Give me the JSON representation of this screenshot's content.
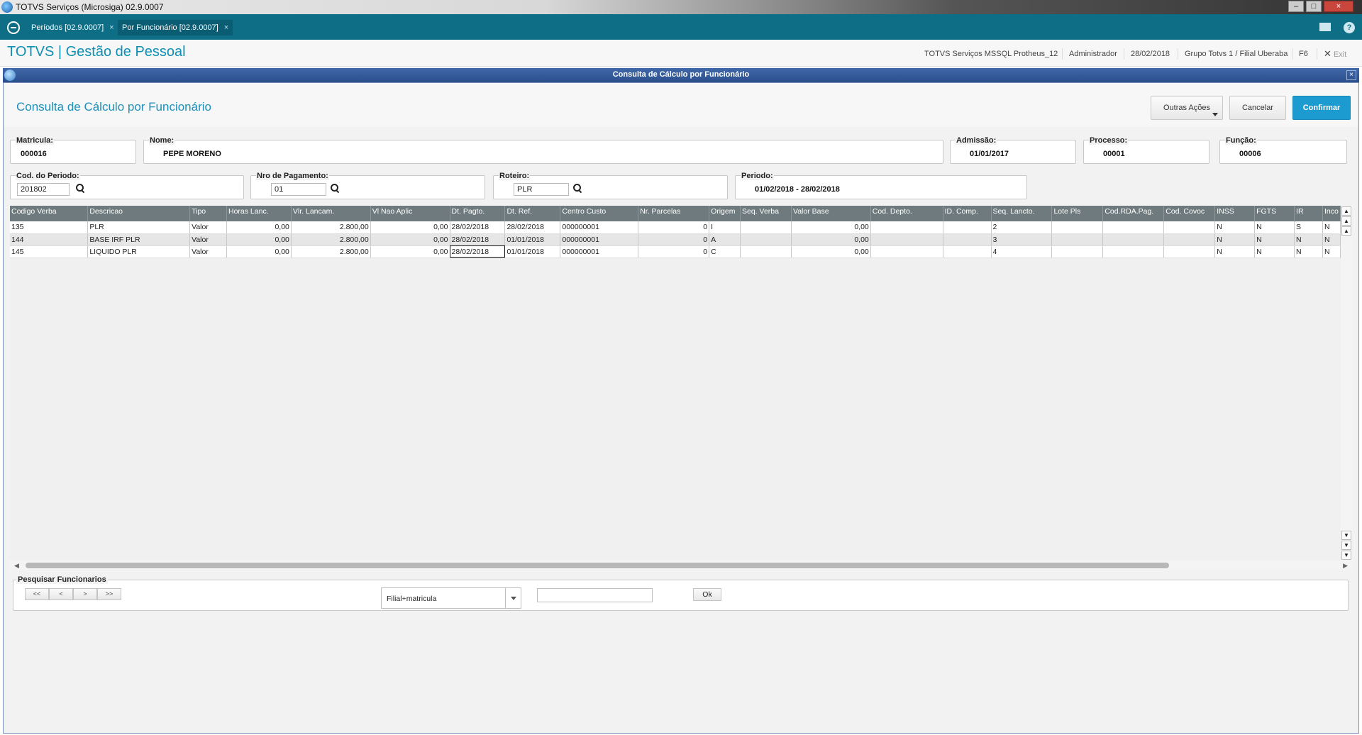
{
  "window": {
    "title": "TOTVS Serviços (Microsiga) 02.9.0007"
  },
  "tabs": [
    {
      "label": "Períodos [02.9.0007]",
      "close": "×"
    },
    {
      "label": "Por Funcionário [02.9.0007]",
      "close": "×"
    }
  ],
  "header": {
    "brand": "TOTVS | Gestão de Pessoal",
    "environment": "TOTVS Serviços MSSQL Protheus_12",
    "user": "Administrador",
    "date": "28/02/2018",
    "branch": "Grupo Totvs 1 / Filial Uberaba",
    "shortcut": "F6",
    "exit_label": "Exit",
    "help": "?"
  },
  "dialog": {
    "title": "Consulta de Cálculo por Funcionário",
    "heading": "Consulta de Cálculo por Funcionário",
    "buttons": {
      "more_actions": "Outras Ações",
      "cancel": "Cancelar",
      "confirm": "Confirmar"
    }
  },
  "fields": {
    "matricula": {
      "label": "Matricula:",
      "value": "000016"
    },
    "nome": {
      "label": "Nome:",
      "value": "PEPE MORENO"
    },
    "admissao": {
      "label": "Admissão:",
      "value": "01/01/2017"
    },
    "processo": {
      "label": "Processo:",
      "value": "00001"
    },
    "funcao": {
      "label": "Função:",
      "value": "00006"
    },
    "cod_periodo": {
      "label": "Cod. do Periodo:",
      "value": "201802"
    },
    "nro_pagamento": {
      "label": "Nro de Pagamento:",
      "value": "01"
    },
    "roteiro": {
      "label": "Roteiro:",
      "value": "PLR"
    },
    "periodo": {
      "label": "Periodo:",
      "value": "01/02/2018 - 28/02/2018"
    }
  },
  "grid": {
    "columns": [
      "Codigo Verba",
      "Descricao",
      "Tipo",
      "Horas Lanc.",
      "Vlr. Lancam.",
      "Vl Nao Aplic",
      "Dt. Pagto.",
      "Dt. Ref.",
      "Centro Custo",
      "Nr. Parcelas",
      "Origem",
      "Seq. Verba",
      "Valor Base",
      "Cod. Depto.",
      "ID. Comp.",
      "Seq. Lancto.",
      "Lote Pls",
      "Cod.RDA.Pag.",
      "Cod. Covoc",
      "INSS",
      "FGTS",
      "IR",
      "Inco"
    ],
    "rows": [
      [
        "135",
        "PLR",
        "Valor",
        "0,00",
        "2.800,00",
        "0,00",
        "28/02/2018",
        "28/02/2018",
        "000000001",
        "0",
        "I",
        "",
        "0,00",
        "",
        "",
        "2",
        "",
        "",
        "",
        "N",
        "N",
        "S",
        "N"
      ],
      [
        "144",
        "BASE IRF PLR",
        "Valor",
        "0,00",
        "2.800,00",
        "0,00",
        "28/02/2018",
        "01/01/2018",
        "000000001",
        "0",
        "A",
        "",
        "0,00",
        "",
        "",
        "3",
        "",
        "",
        "",
        "N",
        "N",
        "N",
        "N"
      ],
      [
        "145",
        "LIQUIDO PLR",
        "Valor",
        "0,00",
        "2.800,00",
        "0,00",
        "28/02/2018",
        "01/01/2018",
        "000000001",
        "0",
        "C",
        "",
        "0,00",
        "",
        "",
        "4",
        "",
        "",
        "",
        "N",
        "N",
        "N",
        "N"
      ]
    ]
  },
  "search": {
    "label": "Pesquisar Funcionarios",
    "nav": [
      "<<",
      "<",
      ">",
      ">>"
    ],
    "order": "Filial+matricula",
    "query": "",
    "ok": "Ok"
  },
  "colors": {
    "accent": "#0d6e86",
    "brand": "#0e8fb3",
    "confirm": "#1b9bd0",
    "grid_header": "#6e7a7d"
  }
}
